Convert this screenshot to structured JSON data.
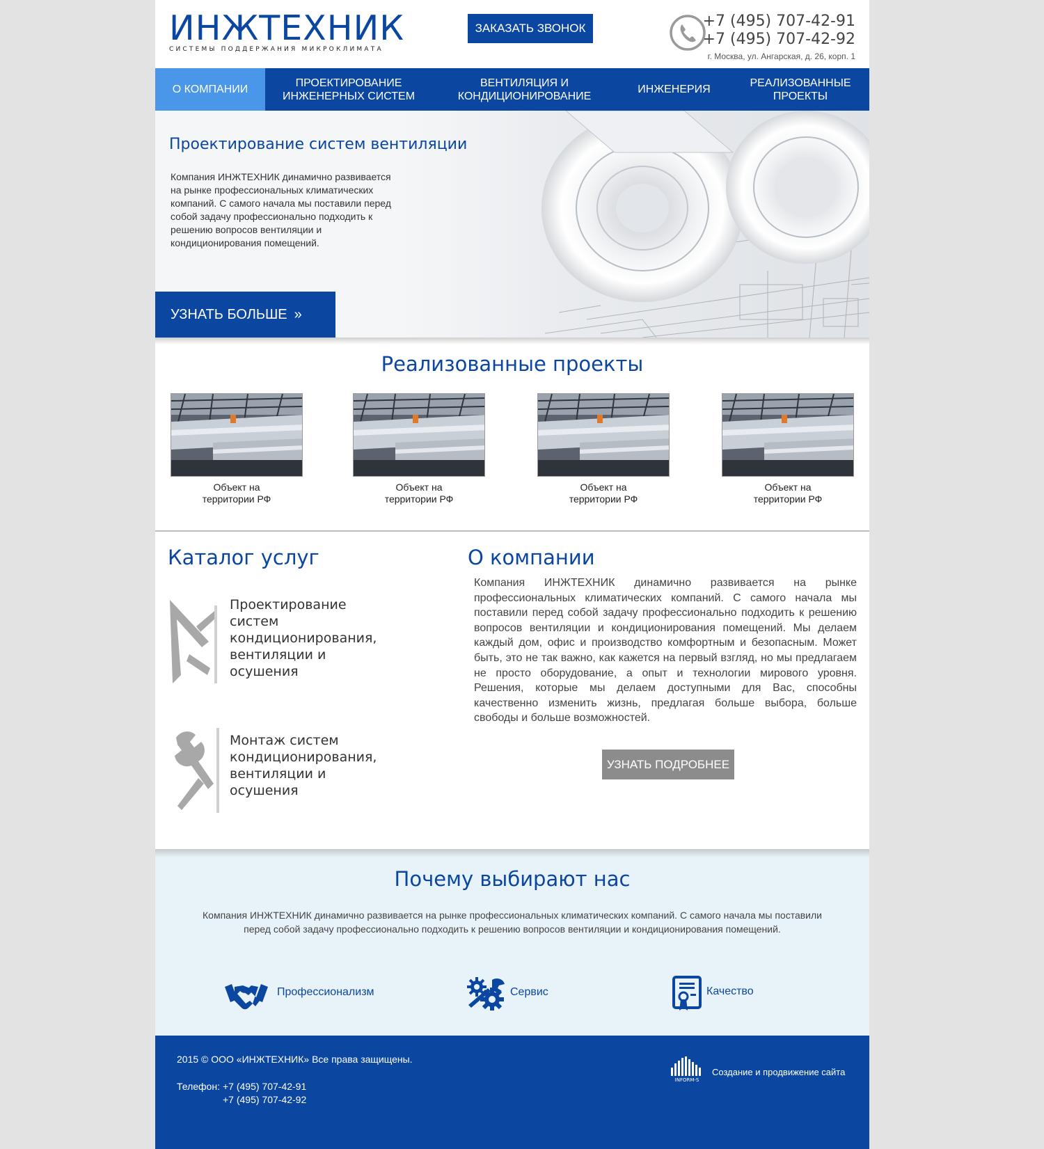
{
  "header": {
    "logo_title": "ИНЖТЕХНИК",
    "logo_subtitle": "СИСТЕМЫ ПОДДЕРЖАНИЯ МИКРОКЛИМАТА",
    "callback_label": "ЗАКАЗАТЬ ЗВОНОК",
    "phone1": "+7 (495) 707-42-91",
    "phone2": "+7 (495) 707-42-92",
    "address": "г. Москва, ул. Ангарская, д. 26, корп. 1"
  },
  "nav": {
    "items": [
      {
        "label": "О КОМПАНИИ"
      },
      {
        "label": "ПРОЕКТИРОВАНИЕ ИНЖЕНЕРНЫХ СИСТЕМ"
      },
      {
        "label": "ВЕНТИЛЯЦИЯ И КОНДИЦИОНИРОВАНИЕ"
      },
      {
        "label": "ИНЖЕНЕРИЯ"
      },
      {
        "label": "РЕАЛИЗОВАННЫЕ ПРОЕКТЫ"
      }
    ]
  },
  "hero": {
    "title": "Проектирование систем вентиляции",
    "text": "Компания ИНЖТЕХНИК динамично развивается на рынке профессиональных климатических компаний. С самого начала мы поставили перед собой задачу профессионально подходить к решению вопросов вентиляции и кондиционирования помещений.",
    "button_label": "УЗНАТЬ БОЛЬШЕ",
    "button_arrow": "»"
  },
  "projects": {
    "title": "Реализованные проекты",
    "items": [
      {
        "caption": "Объект на территории РФ"
      },
      {
        "caption": "Объект на территории РФ"
      },
      {
        "caption": "Объект на территории РФ"
      },
      {
        "caption": "Объект на территории РФ"
      }
    ]
  },
  "catalog": {
    "title": "Каталог услуг",
    "items": [
      {
        "text": "Проектирование систем кондиционирования, вентиляции и осушения",
        "icon": "compass-ruler-icon"
      },
      {
        "text": "Монтаж систем кондиционирования, вентиляции и осушения",
        "icon": "wrench-screwdriver-icon"
      }
    ]
  },
  "about": {
    "title": "О компании",
    "text": "Компания ИНЖТЕХНИК динамично развивается на рынке профессиональных климатических компаний. С самого начала мы поставили перед собой задачу профессионально подходить к решению вопросов вентиляции и кондиционирования помещений. Мы делаем каждый дом, офис и производство комфортным и безопасным. Может быть, это не так важно, как кажется на первый взгляд, но мы предлагаем не просто оборудование, а опыт и технологии мирового уровня. Решения, которые мы делаем доступными для Вас, способны качественно изменить жизнь, предлагая больше выбора, больше свободы и больше возможностей.",
    "button_label": "УЗНАТЬ ПОДРОБНЕЕ"
  },
  "why": {
    "title": "Почему выбирают нас",
    "text": "Компания ИНЖТЕХНИК динамично развивается на рынке профессиональных климатических компаний. С самого начала мы поставили перед собой задачу профессионально подходить к решению вопросов вентиляции и кондиционирования помещений.",
    "features": [
      {
        "label": "Профессионализм",
        "icon": "handshake-icon"
      },
      {
        "label": "Сервис",
        "icon": "gears-wrench-icon"
      },
      {
        "label": "Качество",
        "icon": "certificate-icon"
      }
    ]
  },
  "footer": {
    "copyright": "2015 © ООО «ИНЖТЕХНИК» Все права защищены.",
    "phone_label": "Телефон:",
    "phone1": "+7 (495) 707-42-91",
    "phone2": "+7 (495) 707-42-92",
    "dev_logo_text": "INFORM-S",
    "dev_link": "Создание и продвижение сайта"
  },
  "colors": {
    "brand_blue": "#0b47a1",
    "nav_active": "#4a96e8",
    "why_bg": "#e7f3f8",
    "gray_button": "#8c8c8c"
  }
}
